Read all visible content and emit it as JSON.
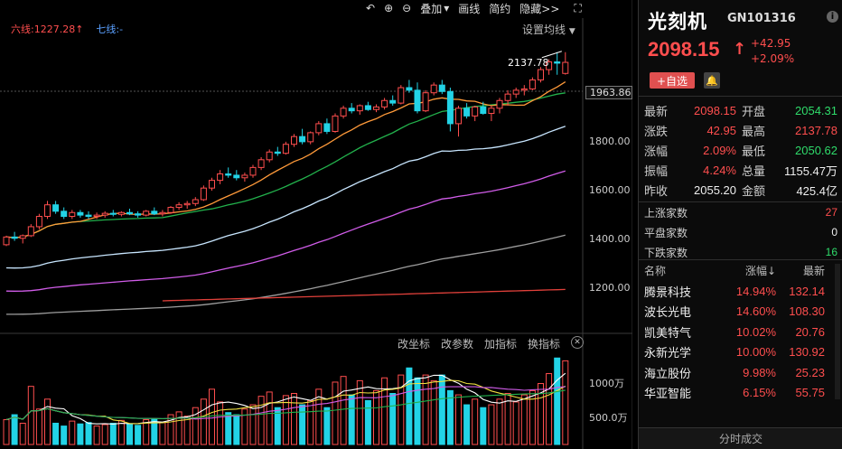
{
  "toolbar": {
    "overlay_label": "叠加",
    "draw_label": "画线",
    "simple_label": "简约",
    "hide_label": "隐藏>>"
  },
  "chart": {
    "ma6_label": "六线:1227.28↑",
    "ma7_label": "七线:-",
    "settings_label": "设置均线",
    "current_price_tag": "1963.86",
    "high_label": "2137.78",
    "y_ticks": [
      "1800.00",
      "1600.00",
      "1400.00",
      "1200.00"
    ],
    "vol_ticks": [
      "1000万",
      "500.0万"
    ],
    "indicator_toolbar": {
      "change_coord": "改坐标",
      "change_param": "改参数",
      "add_indicator": "加指标",
      "swap_indicator": "换指标"
    },
    "colors": {
      "up": "#ff4e4e",
      "down": "#22d3e6",
      "ma5": "#ffffff",
      "ma10": "#ff9a3a",
      "ma20": "#22b14c",
      "ma60": "#c8e6ff",
      "ma120": "#d05ce8",
      "ma250": "#9e9e9e",
      "ma6": "#e0403a"
    }
  },
  "chart_data": {
    "type": "candlestick",
    "y_range": [
      1130,
      2200
    ],
    "candles": [
      [
        1390,
        1425,
        1385,
        1420
      ],
      [
        1420,
        1440,
        1405,
        1415
      ],
      [
        1415,
        1430,
        1395,
        1425
      ],
      [
        1425,
        1470,
        1420,
        1460
      ],
      [
        1460,
        1510,
        1450,
        1500
      ],
      [
        1500,
        1560,
        1490,
        1545
      ],
      [
        1545,
        1560,
        1510,
        1520
      ],
      [
        1520,
        1535,
        1490,
        1500
      ],
      [
        1500,
        1525,
        1490,
        1515
      ],
      [
        1515,
        1525,
        1495,
        1505
      ],
      [
        1505,
        1520,
        1490,
        1500
      ],
      [
        1500,
        1515,
        1490,
        1505
      ],
      [
        1505,
        1520,
        1495,
        1512
      ],
      [
        1512,
        1525,
        1500,
        1508
      ],
      [
        1508,
        1520,
        1500,
        1515
      ],
      [
        1515,
        1530,
        1505,
        1510
      ],
      [
        1510,
        1520,
        1495,
        1505
      ],
      [
        1505,
        1525,
        1500,
        1520
      ],
      [
        1520,
        1535,
        1505,
        1510
      ],
      [
        1510,
        1525,
        1500,
        1515
      ],
      [
        1515,
        1540,
        1510,
        1535
      ],
      [
        1535,
        1555,
        1525,
        1545
      ],
      [
        1545,
        1560,
        1530,
        1550
      ],
      [
        1550,
        1575,
        1540,
        1565
      ],
      [
        1565,
        1620,
        1560,
        1610
      ],
      [
        1610,
        1650,
        1600,
        1640
      ],
      [
        1640,
        1680,
        1625,
        1665
      ],
      [
        1665,
        1690,
        1650,
        1660
      ],
      [
        1660,
        1680,
        1640,
        1650
      ],
      [
        1650,
        1670,
        1635,
        1660
      ],
      [
        1660,
        1700,
        1650,
        1690
      ],
      [
        1690,
        1730,
        1680,
        1720
      ],
      [
        1720,
        1760,
        1710,
        1750
      ],
      [
        1750,
        1770,
        1735,
        1745
      ],
      [
        1745,
        1790,
        1740,
        1780
      ],
      [
        1780,
        1820,
        1770,
        1810
      ],
      [
        1810,
        1840,
        1780,
        1790
      ],
      [
        1790,
        1830,
        1780,
        1825
      ],
      [
        1825,
        1870,
        1815,
        1860
      ],
      [
        1860,
        1880,
        1820,
        1830
      ],
      [
        1830,
        1900,
        1825,
        1890
      ],
      [
        1890,
        1930,
        1880,
        1920
      ],
      [
        1920,
        1940,
        1900,
        1910
      ],
      [
        1910,
        1935,
        1895,
        1930
      ],
      [
        1930,
        1945,
        1910,
        1915
      ],
      [
        1915,
        1935,
        1905,
        1925
      ],
      [
        1925,
        1960,
        1915,
        1950
      ],
      [
        1950,
        1970,
        1930,
        1940
      ],
      [
        1940,
        2010,
        1935,
        2000
      ],
      [
        2000,
        2030,
        1980,
        1990
      ],
      [
        1990,
        2020,
        1900,
        1910
      ],
      [
        1910,
        1990,
        1905,
        1980
      ],
      [
        1980,
        2020,
        1970,
        2010
      ],
      [
        2010,
        2030,
        1975,
        1985
      ],
      [
        1985,
        2000,
        1830,
        1860
      ],
      [
        1860,
        1930,
        1810,
        1920
      ],
      [
        1920,
        1940,
        1880,
        1890
      ],
      [
        1890,
        1930,
        1870,
        1925
      ],
      [
        1925,
        1945,
        1895,
        1900
      ],
      [
        1900,
        1930,
        1870,
        1920
      ],
      [
        1920,
        1960,
        1900,
        1950
      ],
      [
        1950,
        1990,
        1930,
        1975
      ],
      [
        1975,
        2000,
        1960,
        1990
      ],
      [
        1990,
        2010,
        1970,
        1995
      ],
      [
        1995,
        2040,
        1990,
        2030
      ],
      [
        2030,
        2080,
        2020,
        2070
      ],
      [
        2070,
        2110,
        2050,
        2100
      ],
      [
        2100,
        2137.78,
        2050,
        2095
      ],
      [
        2055.2,
        2137.78,
        2050.62,
        2098.15
      ]
    ],
    "volumes": [
      350,
      420,
      300,
      820,
      500,
      640,
      300,
      260,
      330,
      290,
      310,
      260,
      280,
      300,
      340,
      290,
      270,
      350,
      360,
      310,
      420,
      460,
      400,
      520,
      640,
      780,
      600,
      450,
      420,
      500,
      560,
      680,
      740,
      520,
      690,
      720,
      560,
      620,
      780,
      520,
      880,
      960,
      700,
      900,
      620,
      760,
      940,
      720,
      980,
      1080,
      940,
      980,
      900,
      980,
      760,
      700,
      560,
      640,
      520,
      560,
      640,
      720,
      600,
      700,
      760,
      860,
      1000,
      1220,
      1180
    ],
    "indicator": "VOL",
    "unit": "万"
  },
  "panel": {
    "title": "光刻机",
    "code": "GN101316",
    "info": "i",
    "price": "2098.15",
    "change": "+42.95",
    "change_pct": "+2.09%",
    "add_watch": "+自选",
    "quote": [
      {
        "k": "最新",
        "v": "2098.15",
        "vc": "red",
        "k2": "开盘",
        "v2": "2054.31",
        "v2c": "green"
      },
      {
        "k": "涨跌",
        "v": "42.95",
        "vc": "red",
        "k2": "最高",
        "v2": "2137.78",
        "v2c": "red"
      },
      {
        "k": "涨幅",
        "v": "2.09%",
        "vc": "red",
        "k2": "最低",
        "v2": "2050.62",
        "v2c": "green"
      },
      {
        "k": "振幅",
        "v": "4.24%",
        "vc": "red",
        "k2": "总量",
        "v2": "1155.47万",
        "v2c": "white"
      },
      {
        "k": "昨收",
        "v": "2055.20",
        "vc": "white",
        "k2": "金额",
        "v2": "425.4亿",
        "v2c": "white"
      }
    ],
    "breadth": [
      {
        "k": "上涨家数",
        "v": "27",
        "vc": "red"
      },
      {
        "k": "平盘家数",
        "v": "0",
        "vc": "white"
      },
      {
        "k": "下跌家数",
        "v": "16",
        "vc": "green"
      }
    ],
    "list_head": {
      "name": "名称",
      "pct": "涨幅↓",
      "price": "最新"
    },
    "list": [
      {
        "name": "腾景科技",
        "pct": "14.94%",
        "price": "132.14"
      },
      {
        "name": "波长光电",
        "pct": "14.60%",
        "price": "108.30"
      },
      {
        "name": "凯美特气",
        "pct": "10.02%",
        "price": "20.76"
      },
      {
        "name": "永新光学",
        "pct": "10.00%",
        "price": "130.92"
      },
      {
        "name": "海立股份",
        "pct": "9.98%",
        "price": "25.23"
      },
      {
        "name": "华亚智能",
        "pct": "6.15%",
        "price": "55.75"
      }
    ],
    "footer": "分时成交"
  }
}
